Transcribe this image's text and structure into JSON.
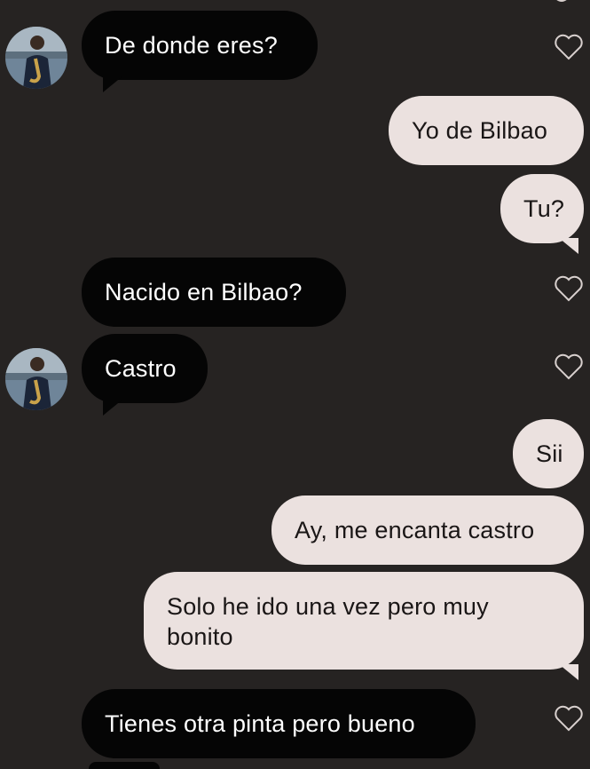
{
  "colors": {
    "background": "#262322",
    "incoming_bubble": "#050505",
    "outgoing_bubble": "#ebe1df",
    "heart_outline": "#d8d0ce"
  },
  "messages": [
    {
      "direction": "incoming",
      "text": "De donde eres?",
      "avatar": true,
      "heart": true
    },
    {
      "direction": "outgoing",
      "text": "Yo de Bilbao"
    },
    {
      "direction": "outgoing",
      "text": "Tu?"
    },
    {
      "direction": "incoming",
      "text": "Nacido en Bilbao?",
      "avatar": false,
      "heart": true
    },
    {
      "direction": "incoming",
      "text": "Castro",
      "avatar": true,
      "heart": true
    },
    {
      "direction": "outgoing",
      "text": "Sii"
    },
    {
      "direction": "outgoing",
      "text": "Ay, me encanta castro"
    },
    {
      "direction": "outgoing",
      "text": "Solo he ido una vez pero muy bonito"
    },
    {
      "direction": "incoming",
      "text": "Tienes otra pinta pero bueno",
      "avatar": false,
      "heart": true
    }
  ],
  "icons": {
    "avatar": "profile-photo-saxophone",
    "like": "heart-outline-icon"
  }
}
